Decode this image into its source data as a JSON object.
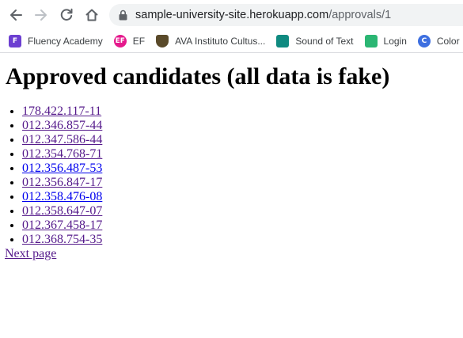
{
  "browser": {
    "url_host": "sample-university-site.herokuapp.com",
    "url_path": "/approvals/1",
    "bookmarks": [
      {
        "label": "Fluency Academy",
        "icon": "fluency-academy-icon",
        "icon_text": "F",
        "color": "#6c3fd1"
      },
      {
        "label": "EF",
        "icon": "ef-icon",
        "icon_text": "EF",
        "color": "#e5198c"
      },
      {
        "label": "AVA Instituto Cultus...",
        "icon": "ava-shield-icon",
        "icon_text": "",
        "color": "#5a4a2a"
      },
      {
        "label": "Sound of Text",
        "icon": "sound-of-text-icon",
        "icon_text": "",
        "color": "#0f8a80"
      },
      {
        "label": "Login",
        "icon": "login-icon",
        "icon_text": "",
        "color": "#2bb673"
      },
      {
        "label": "Color",
        "icon": "color-icon",
        "icon_text": "C",
        "color": "#3d6fe0"
      }
    ]
  },
  "page": {
    "heading": "Approved candidates (all data is fake)",
    "candidates": [
      "178.422.117-11",
      "012.346.857-44",
      "012.347.586-44",
      "012.354.768-71",
      "012.356.487-53",
      "012.356.847-17",
      "012.358.476-08",
      "012.358.647-07",
      "012.367.458-17",
      "012.368.754-35"
    ],
    "next_page_label": "Next page"
  },
  "colors": {
    "visited_link": "#551a8b",
    "unvisited_link": "#0000ee"
  }
}
